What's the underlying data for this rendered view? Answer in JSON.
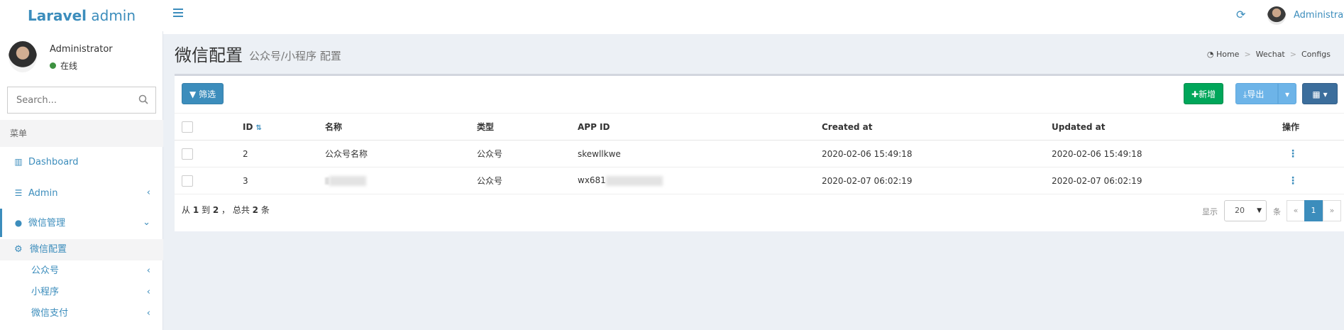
{
  "header": {
    "logo_bold": "Laravel",
    "logo_rest": " admin",
    "user_name": "Administrator"
  },
  "sidebar": {
    "user_name": "Administrator",
    "status": "在线",
    "search_placeholder": "Search...",
    "menu_header": "菜单",
    "items": [
      {
        "label": "Dashboard",
        "icon": "bar-chart-icon"
      },
      {
        "label": "Admin",
        "icon": "tasks-icon"
      },
      {
        "label": "微信管理",
        "icon": "wechat-icon"
      }
    ],
    "sub_items": [
      {
        "label": "微信配置",
        "icon": "gear-icon"
      },
      {
        "label": "公众号"
      },
      {
        "label": "小程序"
      },
      {
        "label": "微信支付"
      }
    ]
  },
  "page": {
    "title": "微信配置",
    "subtitle": "公众号/小程序 配置",
    "breadcrumb": [
      "Home",
      "Wechat",
      "Configs"
    ]
  },
  "toolbar": {
    "filter": "筛选",
    "new": "新增",
    "export": "导出"
  },
  "table": {
    "headers": [
      "ID",
      "名称",
      "类型",
      "APP ID",
      "Created at",
      "Updated at",
      "操作"
    ],
    "rows": [
      {
        "id": "2",
        "name": "公众号名称",
        "type": "公众号",
        "app_id": "skewllkwe",
        "created": "2020-02-06 15:49:18",
        "updated": "2020-02-06 15:49:18"
      },
      {
        "id": "3",
        "name": "",
        "type": "公众号",
        "app_id": "wx681",
        "created": "2020-02-07 06:02:19",
        "updated": "2020-02-07 06:02:19"
      }
    ]
  },
  "footer": {
    "summary_pre": "从 ",
    "from": "1",
    "summary_mid1": " 到 ",
    "to": "2",
    "summary_mid2": " ， 总共 ",
    "total": "2",
    "summary_post": " 条",
    "show_label": "显示",
    "per_page": "20",
    "per_page_unit": "条",
    "prev": "«",
    "current_page": "1",
    "next": "»"
  }
}
